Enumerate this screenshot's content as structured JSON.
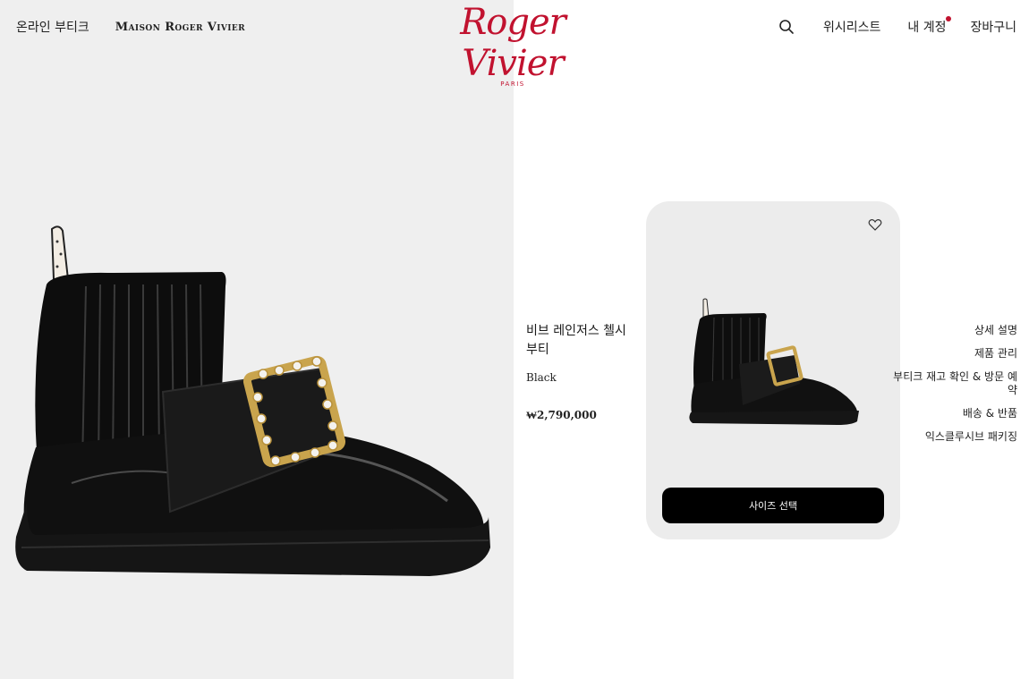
{
  "header": {
    "online_boutique": "온라인 부티크",
    "maison": "Maison Roger Vivier",
    "logo_text": "Roger Vivier",
    "logo_city": "PARIS",
    "wishlist": "위시리스트",
    "account": "내 계정",
    "cart": "장바구니"
  },
  "product": {
    "name": "비브 레인저스 첼시 부티",
    "color": "Black",
    "price": "₩2,790,000"
  },
  "card": {
    "size_button": "사이즈 선택"
  },
  "menu": {
    "items": [
      "상세 설명",
      "제품 관리",
      "부티크 재고 확인 & 방문 예약",
      "배송 & 반품",
      "익스클루시브 패키징"
    ]
  },
  "colors": {
    "brand": "#c1122f",
    "button": "#000000",
    "panel": "#efefef"
  },
  "icons": {
    "search": "search-icon",
    "heart": "heart-icon",
    "notification": "notification-dot"
  }
}
